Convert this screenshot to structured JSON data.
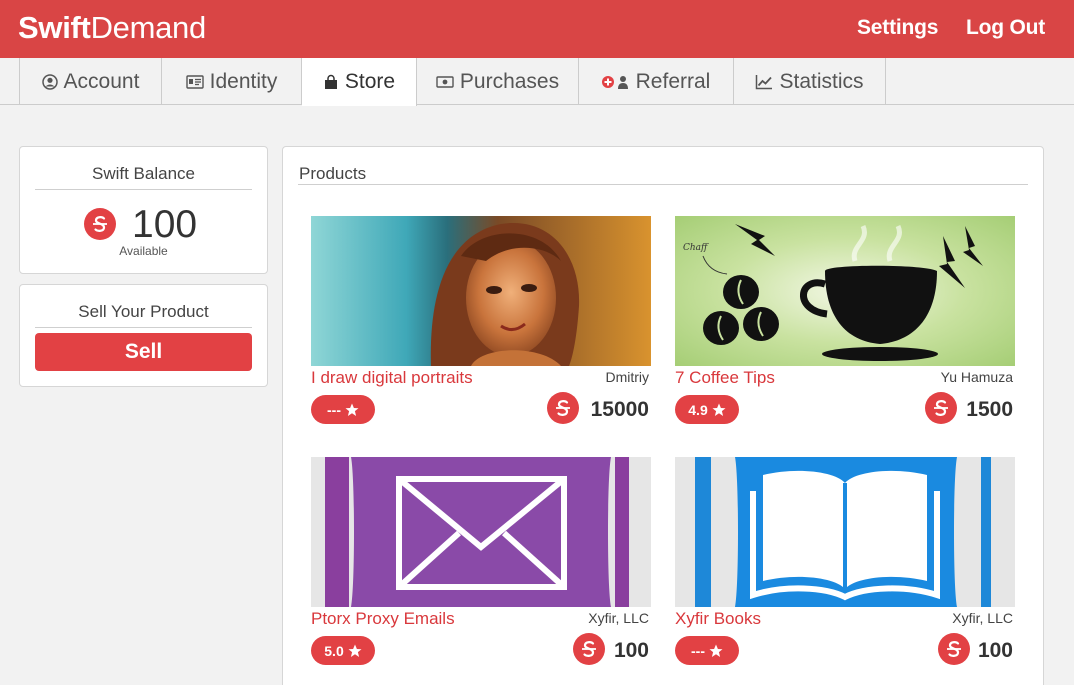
{
  "app": {
    "brand_bold": "Swift",
    "brand_light": "Demand",
    "settings_label": "Settings",
    "logout_label": "Log Out",
    "brand_color": "#d94545"
  },
  "tabs": [
    {
      "label": "Account",
      "icon": "user-circle-icon"
    },
    {
      "label": "Identity",
      "icon": "id-card-icon"
    },
    {
      "label": "Store",
      "icon": "shopping-bag-icon",
      "active": true
    },
    {
      "label": "Purchases",
      "icon": "money-bill-icon"
    },
    {
      "label": "Referral",
      "icon": "add-user-icon"
    },
    {
      "label": "Statistics",
      "icon": "line-chart-icon"
    }
  ],
  "balance": {
    "title": "Swift Balance",
    "amount": "100",
    "caption": "Available"
  },
  "sell": {
    "title": "Sell Your Product",
    "button_label": "Sell"
  },
  "products": {
    "title": "Products",
    "items": [
      {
        "name": "I draw digital portraits",
        "seller": "Dmitriy",
        "rating": "---",
        "price": "15000",
        "image": "portrait"
      },
      {
        "name": "7 Coffee Tips",
        "seller": "Yu Hamuza",
        "rating": "4.9",
        "price": "1500",
        "image": "coffee",
        "image_label": "Chaff"
      },
      {
        "name": "Ptorx Proxy Emails",
        "seller": "Xyfir, LLC",
        "rating": "5.0",
        "price": "100",
        "image": "envelope"
      },
      {
        "name": "Xyfir Books",
        "seller": "Xyfir, LLC",
        "rating": "---",
        "price": "100",
        "image": "book"
      }
    ]
  }
}
